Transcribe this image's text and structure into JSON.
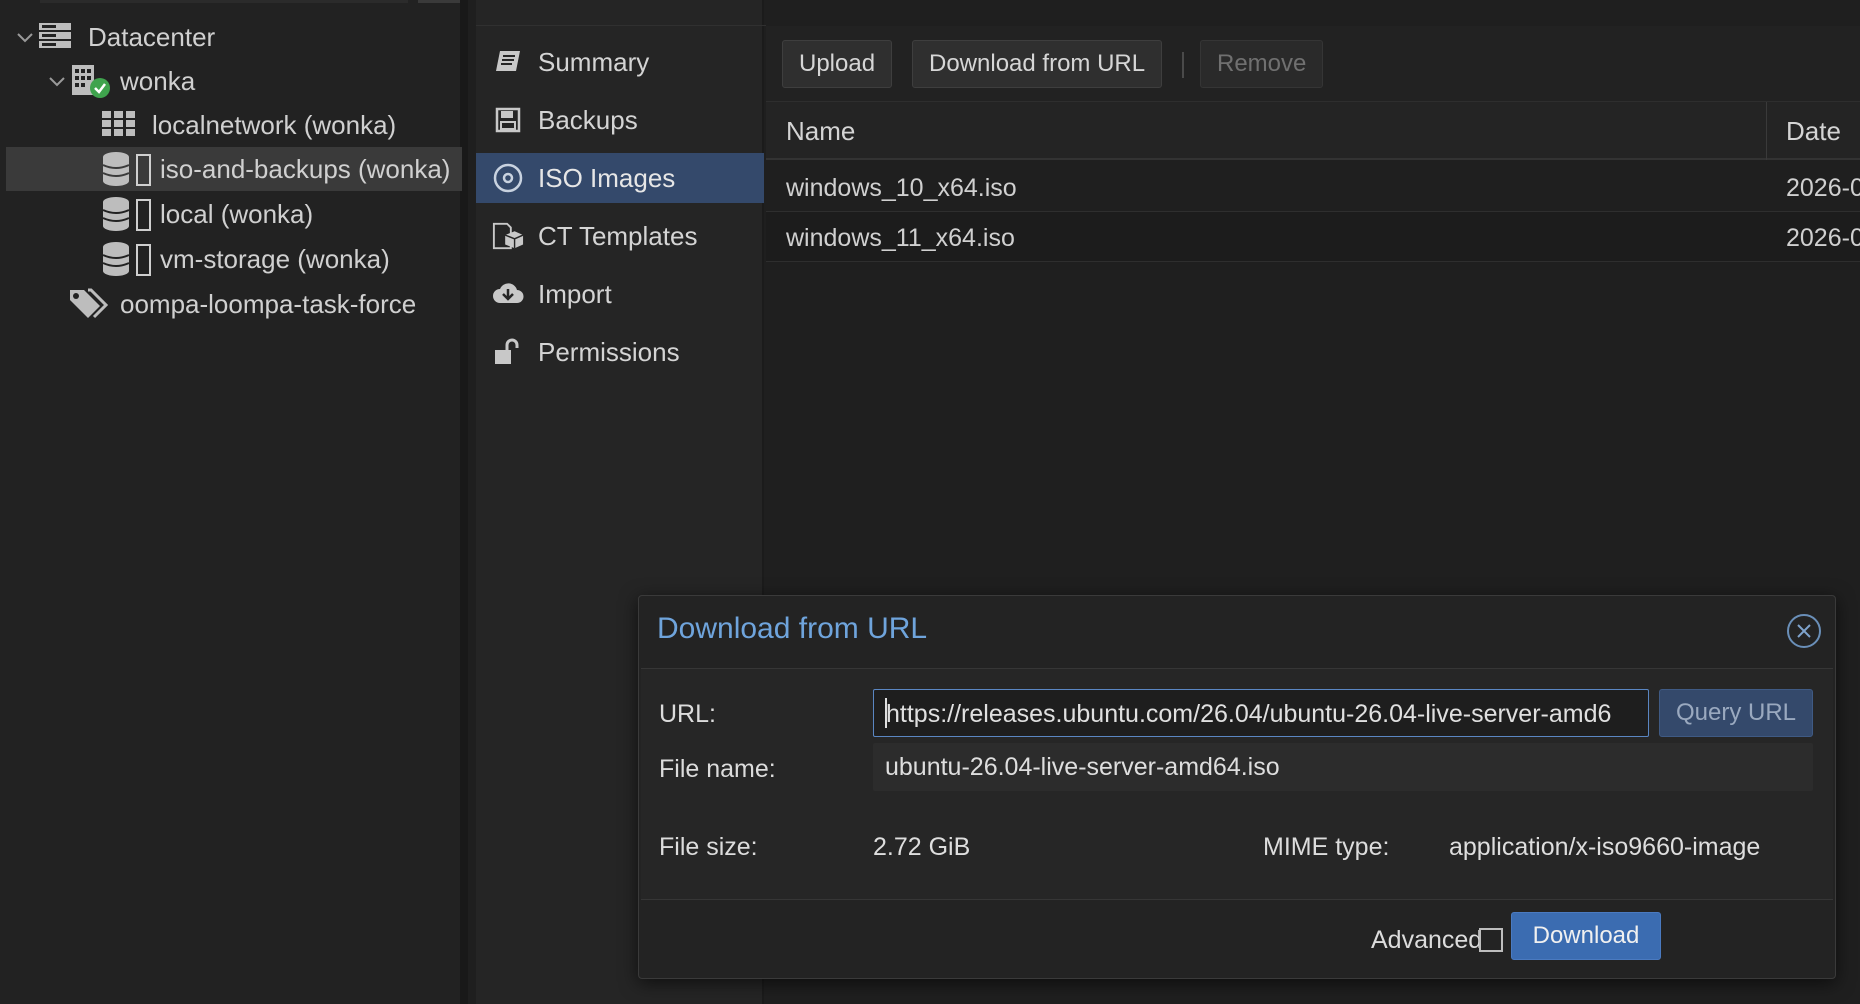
{
  "tree": {
    "items": [
      {
        "label": "Datacenter",
        "icon": "datacenter-icon"
      },
      {
        "label": "wonka",
        "icon": "node-online-icon"
      },
      {
        "label": "localnetwork (wonka)",
        "icon": "sdn-zone-icon"
      },
      {
        "label": "iso-and-backups (wonka)",
        "icon": "storage-icon",
        "selected": true
      },
      {
        "label": "local (wonka)",
        "icon": "storage-icon"
      },
      {
        "label": "vm-storage (wonka)",
        "icon": "storage-icon"
      },
      {
        "label": "oompa-loompa-task-force",
        "icon": "tags-icon"
      }
    ]
  },
  "nav": {
    "items": [
      {
        "label": "Summary",
        "icon": "book-icon"
      },
      {
        "label": "Backups",
        "icon": "floppy-icon"
      },
      {
        "label": "ISO Images",
        "icon": "disc-icon",
        "active": true
      },
      {
        "label": "CT Templates",
        "icon": "templates-icon"
      },
      {
        "label": "Import",
        "icon": "cloud-download-icon"
      },
      {
        "label": "Permissions",
        "icon": "unlock-icon"
      }
    ]
  },
  "toolbar": {
    "upload": "Upload",
    "download_url": "Download from URL",
    "remove": "Remove"
  },
  "grid": {
    "columns": {
      "name": "Name",
      "date": "Date"
    },
    "rows": [
      {
        "name": "windows_10_x64.iso",
        "date": "2026-0"
      },
      {
        "name": "windows_11_x64.iso",
        "date": "2026-0"
      }
    ]
  },
  "dialog": {
    "title": "Download from URL",
    "url_label": "URL:",
    "url_value": "https://releases.ubuntu.com/26.04/ubuntu-26.04-live-server-amd6",
    "query_button": "Query URL",
    "filename_label": "File name:",
    "filename_value": "ubuntu-26.04-live-server-amd64.iso",
    "filesize_label": "File size:",
    "filesize_value": "2.72 GiB",
    "mime_label": "MIME type:",
    "mime_value": "application/x-iso9660-image",
    "advanced_label": "Advanced",
    "download_button": "Download"
  },
  "colors": {
    "accent": "#3b6cb1",
    "nav_active": "#34496b",
    "title_blue": "#6fa4dc",
    "node_ok": "#3fa34d"
  }
}
